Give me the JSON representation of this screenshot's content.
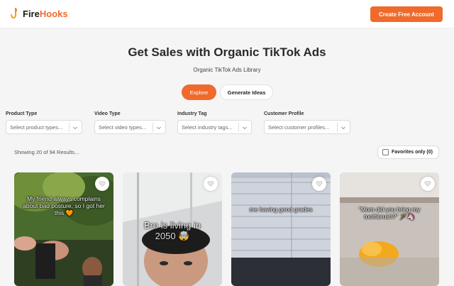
{
  "header": {
    "logo_part1": "Fire",
    "logo_part2": "Hooks",
    "cta_label": "Create Free Account"
  },
  "hero": {
    "title": "Get Sales with Organic TikTok Ads",
    "subtitle": "Organic TikTok Ads Library"
  },
  "tabs": [
    {
      "label": "Explore",
      "active": true
    },
    {
      "label": "Generate Ideas",
      "active": false
    }
  ],
  "filters": [
    {
      "label": "Product Type",
      "placeholder": "Select product types..."
    },
    {
      "label": "Video Type",
      "placeholder": "Select video types..."
    },
    {
      "label": "Industry Tag",
      "placeholder": "Select industry tags..."
    },
    {
      "label": "Customer Profile",
      "placeholder": "Select customer profiles..."
    }
  ],
  "results": {
    "text": "Showing 20 of 94 Results...",
    "favorites_label": "Favorites only (0)"
  },
  "cards": [
    {
      "caption": "My friend always complains about bad posture, so I got her this 🧡"
    },
    {
      "caption": "Bro is living in 2050 🤯"
    },
    {
      "caption": "me having good grades"
    },
    {
      "caption": "\"Mom did you bring my toothbrush?\" 🪄🦄"
    }
  ],
  "colors": {
    "accent": "#f06a2c",
    "background": "#f5f5f5"
  },
  "icons": {
    "logo": "hook-icon",
    "dropdown": "chevron-down-icon",
    "favorite": "heart-icon"
  }
}
